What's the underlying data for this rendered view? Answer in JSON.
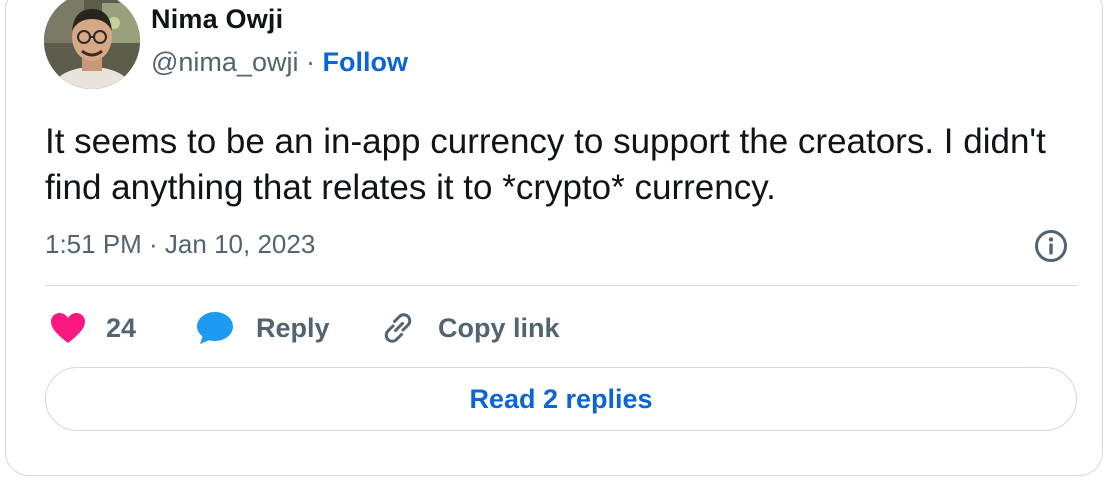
{
  "author": {
    "name": "Nima Owji",
    "handle": "@nima_owji",
    "separator": " · ",
    "follow_label": "Follow"
  },
  "tweet": {
    "text": "It seems to be an in-app currency to support the creators. I didn't find anything that relates it to *crypto* currency.",
    "timestamp": "1:51 PM · Jan 10, 2023"
  },
  "actions": {
    "like_count": "24",
    "reply_label": "Reply",
    "copy_link_label": "Copy link"
  },
  "read_replies_label": "Read 2 replies",
  "icons": {
    "like": "heart-icon",
    "reply": "speech-bubble-icon",
    "copy": "link-icon",
    "info": "info-icon"
  },
  "colors": {
    "like": "#f91880",
    "reply": "#1d9bf0",
    "link": "#0c65d6",
    "muted": "#536471",
    "text": "#0f1419",
    "border": "#cfd9de"
  }
}
